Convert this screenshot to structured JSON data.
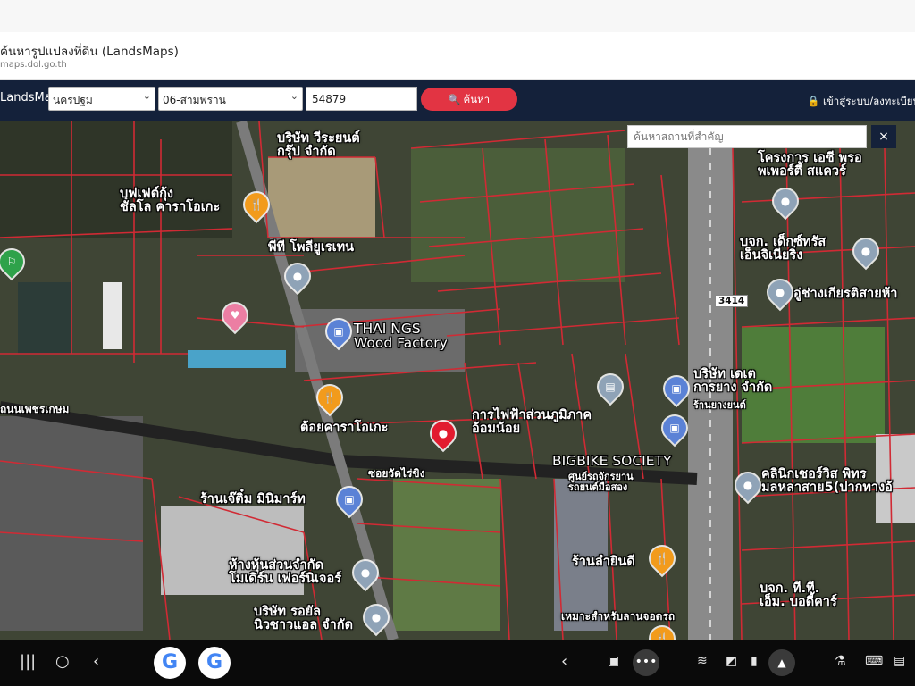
{
  "browser": {
    "title": "ค้นหารูปแปลงที่ดิน (LandsMaps)",
    "url": "maps.dol.go.th"
  },
  "app": {
    "brand": "LandsMaps",
    "province_select": "นครปฐม",
    "district_select": "06-สามพราน",
    "parcel_number": "54879",
    "search_button_label": "ค้นหา",
    "login_label": "เข้าสู่ระบบ/ลงทะเบียน"
  },
  "map": {
    "place_search_placeholder": "ค้นหาสถานที่สำคัญ",
    "close_symbol": "×",
    "labels": {
      "company_top": "บริษัท วีระยนต์\nกรุ๊ป จำกัด",
      "buffet": "บุฟเฟต์กุ้ง\nชัลโล คาราโอเกะ",
      "polymer": "พีที โพลียูเรเทน",
      "project_top_right": "โครงการ เอซี พรอ\nพเพอร์ตี้ สแควร์",
      "kids_company": "บจก. เด็กซ์ทรัส\nเอ็นจิเนียริ่ง",
      "garage": "อู่ช่างเกียรติสายห้า",
      "thai_ngs": "THAI NGS\nWood Factory",
      "company_mid": "บริษัท เดเต\nการยาง จำกัด",
      "repair_shop": "ร้านยางยนต์",
      "karaoke": "ต้อยคาราโอเกะ",
      "electric_authority": "การไฟฟ้าส่วนภูมิภาค\nอ้อมน้อย",
      "bigbike": "BIGBIKE SOCIETY",
      "bigbike_sub": "ศูนย์รถจักรยาน\nรถยนต์มือสอง",
      "clinic": "คลินิกเซอร์วิส พิทร\nมลหลาสาย5(ปากทางอ้",
      "minimart": "ร้านเจ๊ติ๋ม มินิมาร์ท",
      "department_store": "ห้างหุ้นส่วนจำกัด\nโมเดิร์น เฟอร์นิเจอร์",
      "company_bottom": "บริษัท รอยัล\nนิวซาวแอล จำกัด",
      "restaurant": "ร้านลำยินดี",
      "store_bottom": "บจก. ที.ที.\nเอ็ม. บอดี้คาร์",
      "market_bottom": "เหมาะสำหรับลานจอดรถ"
    },
    "road_sign": "3414",
    "road_name_left": "ถนนเพชรเกษม",
    "road_name_center": "ซอยวัดไร่ขิง"
  },
  "taskbar": {
    "apps": [
      "google-app-icon",
      "google-app-icon"
    ]
  }
}
